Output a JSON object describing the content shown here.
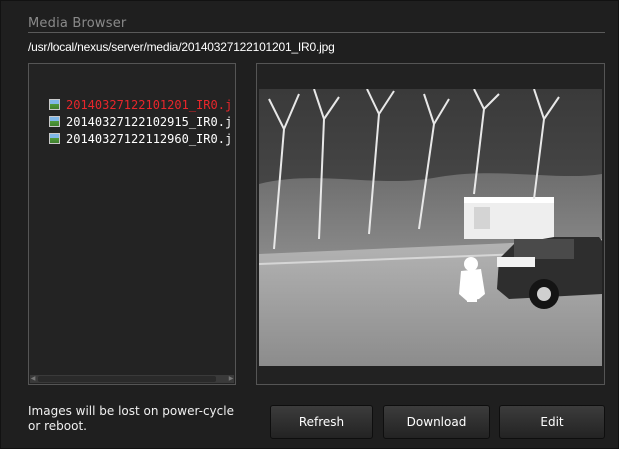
{
  "window": {
    "title": "Media Browser",
    "path": "/usr/local/nexus/server/media/20140327122101201_IR0.jpg"
  },
  "file_list": {
    "items": [
      {
        "label": "20140327122101201_IR0.j",
        "selected": true,
        "icon": "image-file-icon"
      },
      {
        "label": "20140327122102915_IR0.j",
        "selected": false,
        "icon": "image-file-icon"
      },
      {
        "label": "20140327122112960_IR0.j",
        "selected": false,
        "icon": "image-file-icon"
      }
    ],
    "selected_color": "#e8262b"
  },
  "preview": {
    "description_icon": "thermal-image-preview"
  },
  "footer": {
    "note": "Images will be lost on power-cycle or reboot.",
    "refresh_label": "Refresh",
    "download_label": "Download",
    "edit_label": "Edit"
  }
}
